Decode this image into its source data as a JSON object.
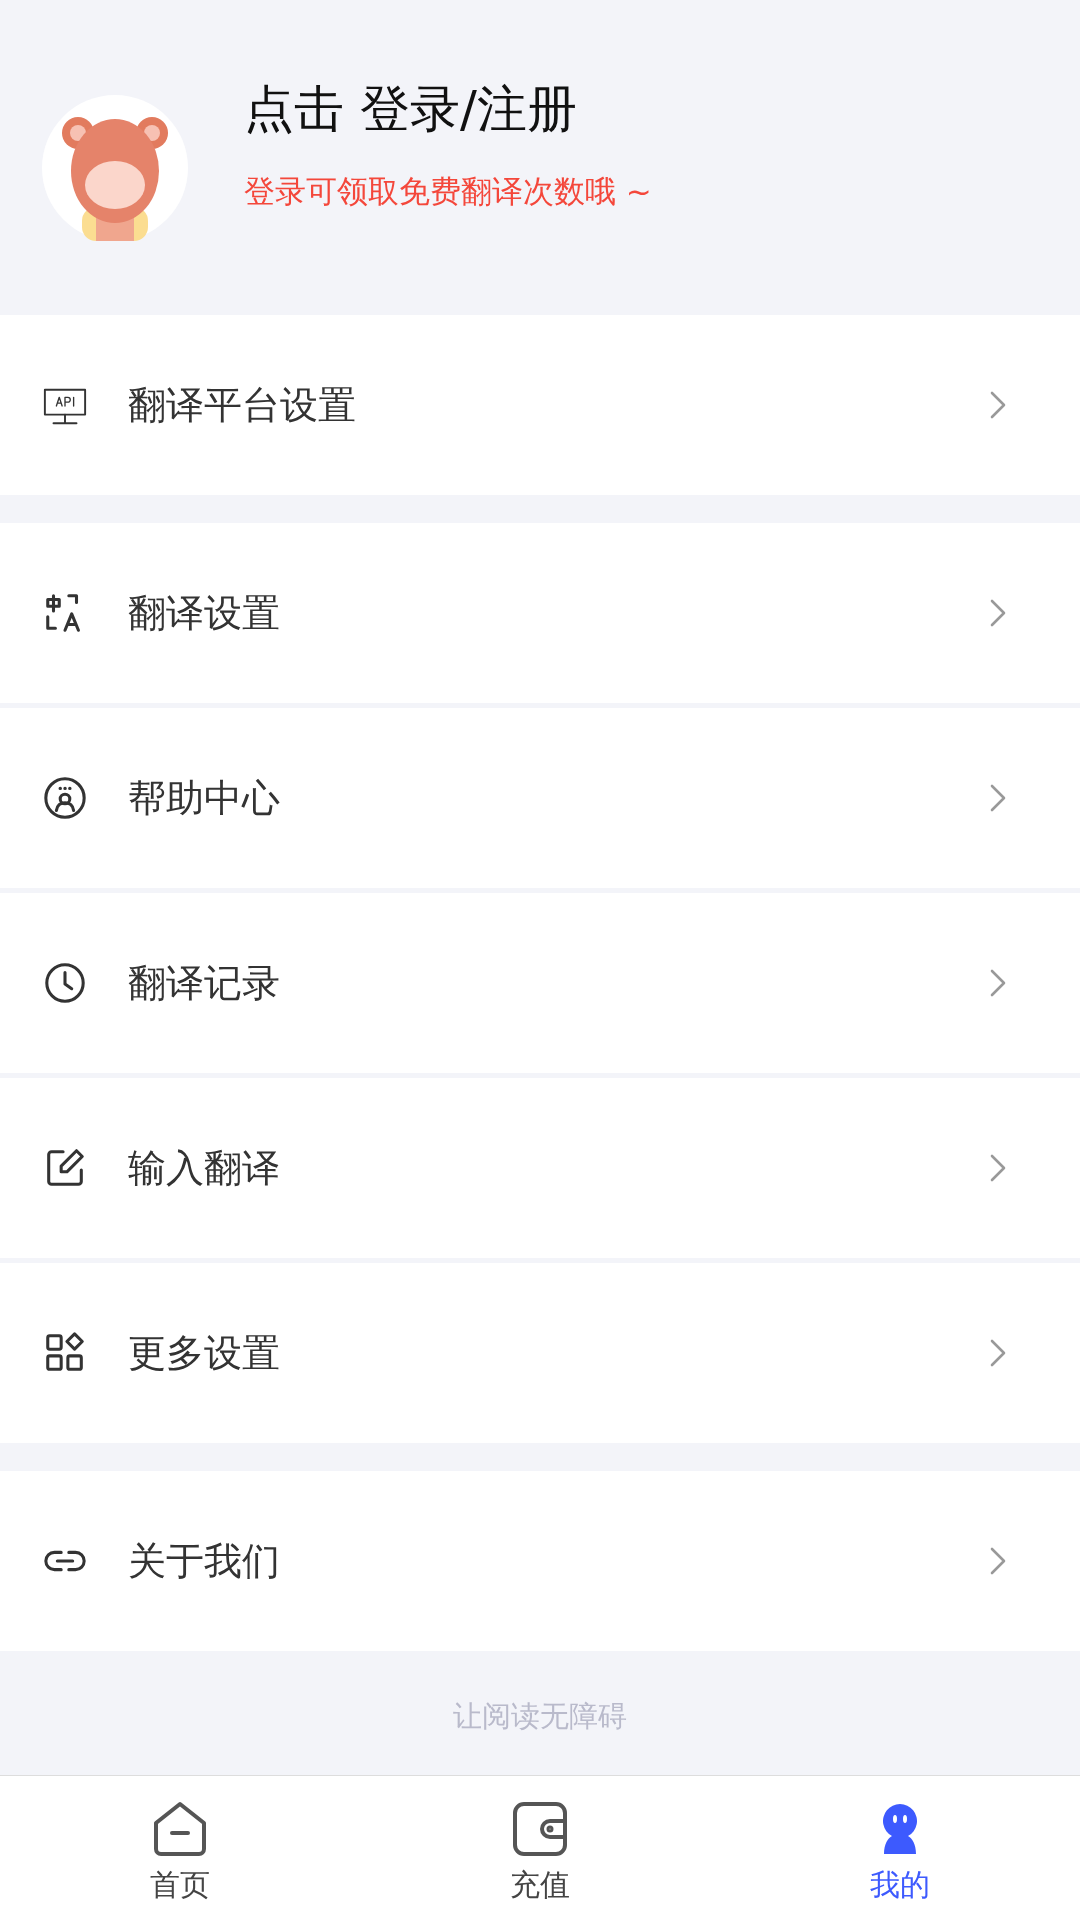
{
  "profile": {
    "title": "点击 登录/注册",
    "subtitle": "登录可领取免费翻译次数哦 ~"
  },
  "sections": [
    {
      "items": [
        {
          "kind": "api",
          "label": "翻译平台设置"
        }
      ]
    },
    {
      "items": [
        {
          "kind": "translate",
          "label": "翻译设置"
        },
        {
          "kind": "help",
          "label": "帮助中心"
        },
        {
          "kind": "history",
          "label": "翻译记录"
        },
        {
          "kind": "edit",
          "label": "输入翻译"
        },
        {
          "kind": "apps",
          "label": "更多设置"
        }
      ]
    },
    {
      "items": [
        {
          "kind": "link",
          "label": "关于我们"
        }
      ]
    }
  ],
  "footer": {
    "slogan": "让阅读无障碍"
  },
  "tabs": [
    {
      "kind": "home",
      "label": "首页",
      "selected": false
    },
    {
      "kind": "wallet",
      "label": "充值",
      "selected": false
    },
    {
      "kind": "user",
      "label": "我的",
      "selected": true
    }
  ]
}
